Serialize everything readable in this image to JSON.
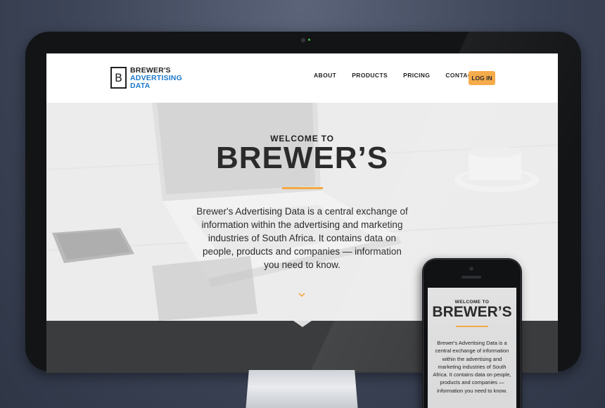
{
  "site": {
    "logo": {
      "mark": "B",
      "line1": "BREWER'S",
      "line2": "ADVERTISING",
      "line3": "DATA"
    },
    "nav": [
      {
        "label": "ABOUT"
      },
      {
        "label": "PRODUCTS"
      },
      {
        "label": "PRICING"
      },
      {
        "label": "CONTACT"
      }
    ],
    "login_label": "LOG IN"
  },
  "hero": {
    "kicker": "WELCOME TO",
    "title": "BREWER’S",
    "description": "Brewer's Advertising Data is a central exchange of information within the advertising and marketing industries of South Africa. It contains data on people, products and companies — information you need to know."
  },
  "mobile": {
    "kicker": "WELCOME TO",
    "title": "BREWER’S",
    "description": "Brewer's Advertising Data is a central exchange of information within the advertising and marketing industries of South Africa. It contains data on people, products and companies — information you need to know."
  },
  "colors": {
    "accent": "#f5a844",
    "brand_blue": "#1c78c9",
    "dark_band": "#3b3c3e"
  },
  "icons": {
    "scroll": "chevron-down-icon"
  }
}
